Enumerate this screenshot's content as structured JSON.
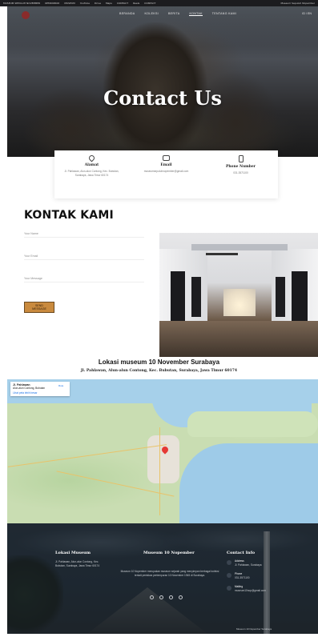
{
  "browser": {
    "bookmarks": [
      "MUSEUM SEPULUH NOVEMBER",
      "KEMDIKBUD",
      "MUSEUM",
      "YouTube",
      "Drive",
      "Maps",
      "CONTACT",
      "Reels",
      "CONTACT"
    ],
    "right": "Museum Sepuluh Nopember"
  },
  "nav": {
    "links": [
      "BERANDA",
      "KOLEKSI",
      "BERITA",
      "KONTAK",
      "TENTANG KAMI"
    ],
    "active_index": 3,
    "lang": "ID / EN"
  },
  "hero": {
    "title": "Contact Us"
  },
  "info": {
    "address": {
      "icon": "location-pin-icon",
      "title": "Alamat",
      "text": "Jl. Pahlawan, Alun-alun Contong, Kec. Bubutan, Surabaya, Jawa Timur 60174"
    },
    "email": {
      "icon": "mail-icon",
      "title": "Email",
      "text": "museumsepuluhnopember@gmail.com"
    },
    "phone": {
      "icon": "phone-icon",
      "title": "Phone Number",
      "text": "031-3571100"
    }
  },
  "kontak": {
    "title": "KONTAK KAMI",
    "fields": [
      {
        "placeholder": "Your Name"
      },
      {
        "placeholder": "Your Email"
      },
      {
        "placeholder": "Your Message"
      }
    ],
    "submit_label": "SEND MESSAGE"
  },
  "lokasi": {
    "title": "Lokasi museum 10 November Surabaya",
    "address": "Jl. Pahlawan, Alun-alun Contong, Kec. Bubutan, Surabaya, Jawa Timur 60174"
  },
  "map": {
    "place_name": "Jl. Pahlawan",
    "place_sub": "Alun-alun Contong, Bubutan",
    "directions": "Rute",
    "larger_map": "Lihat peta lebih besar"
  },
  "footer": {
    "col1": {
      "title": "Lokasi Museum",
      "text": "Jl. Pahlawan, Alun-alun Contong, Kec. Bubutan, Surabaya, Jawa Timur 60174"
    },
    "col2": {
      "title": "Museum 10 Nopember",
      "text": "Museum 10 Nopember merupakan museum sejarah yang menyimpan berbagai koleksi terkait peristiwa pertempuran 10 November 1945 di Surabaya."
    },
    "col3": {
      "title": "Contact Info",
      "items": [
        {
          "label": "Address",
          "value": "Jl. Pahlawan, Surabaya"
        },
        {
          "label": "Phone",
          "value": "031-3571100"
        },
        {
          "label": "Mailing",
          "value": "museum10nop@gmail.com"
        }
      ]
    },
    "copyright": "Museum 10 Nopember Surabaya"
  }
}
